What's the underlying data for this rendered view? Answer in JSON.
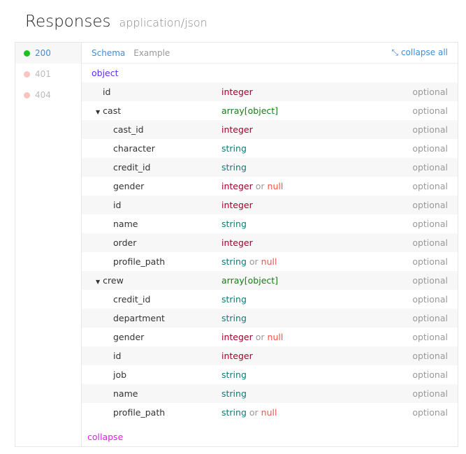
{
  "header": {
    "title": "Responses",
    "content_type": "application/json"
  },
  "codes": [
    {
      "code": "200",
      "color": "#1fbf1f",
      "active": true
    },
    {
      "code": "401",
      "color": "#f8c4c0",
      "active": false
    },
    {
      "code": "404",
      "color": "#f8c4c0",
      "active": false
    }
  ],
  "tabs": {
    "schema": "Schema",
    "example": "Example",
    "collapse_all": "collapse all",
    "collapse_icon": "arrows-in-icon"
  },
  "root_type": "object",
  "rows": [
    {
      "name": "id",
      "level": 0,
      "types": [
        "integer"
      ],
      "req": "optional"
    },
    {
      "name": "cast",
      "level": 0,
      "expand": true,
      "types": [
        "array[object]"
      ],
      "req": "optional"
    },
    {
      "name": "cast_id",
      "level": 1,
      "types": [
        "integer"
      ],
      "req": "optional"
    },
    {
      "name": "character",
      "level": 1,
      "types": [
        "string"
      ],
      "req": "optional"
    },
    {
      "name": "credit_id",
      "level": 1,
      "types": [
        "string"
      ],
      "req": "optional"
    },
    {
      "name": "gender",
      "level": 1,
      "types": [
        "integer",
        "null"
      ],
      "req": "optional"
    },
    {
      "name": "id",
      "level": 1,
      "types": [
        "integer"
      ],
      "req": "optional"
    },
    {
      "name": "name",
      "level": 1,
      "types": [
        "string"
      ],
      "req": "optional"
    },
    {
      "name": "order",
      "level": 1,
      "types": [
        "integer"
      ],
      "req": "optional"
    },
    {
      "name": "profile_path",
      "level": 1,
      "types": [
        "string",
        "null"
      ],
      "req": "optional"
    },
    {
      "name": "crew",
      "level": 0,
      "expand": true,
      "types": [
        "array[object]"
      ],
      "req": "optional"
    },
    {
      "name": "credit_id",
      "level": 1,
      "types": [
        "string"
      ],
      "req": "optional"
    },
    {
      "name": "department",
      "level": 1,
      "types": [
        "string"
      ],
      "req": "optional"
    },
    {
      "name": "gender",
      "level": 1,
      "types": [
        "integer",
        "null"
      ],
      "req": "optional"
    },
    {
      "name": "id",
      "level": 1,
      "types": [
        "integer"
      ],
      "req": "optional"
    },
    {
      "name": "job",
      "level": 1,
      "types": [
        "string"
      ],
      "req": "optional"
    },
    {
      "name": "name",
      "level": 1,
      "types": [
        "string"
      ],
      "req": "optional"
    },
    {
      "name": "profile_path",
      "level": 1,
      "types": [
        "string",
        "null"
      ],
      "req": "optional"
    }
  ],
  "or_word": "or",
  "collapse": "collapse"
}
